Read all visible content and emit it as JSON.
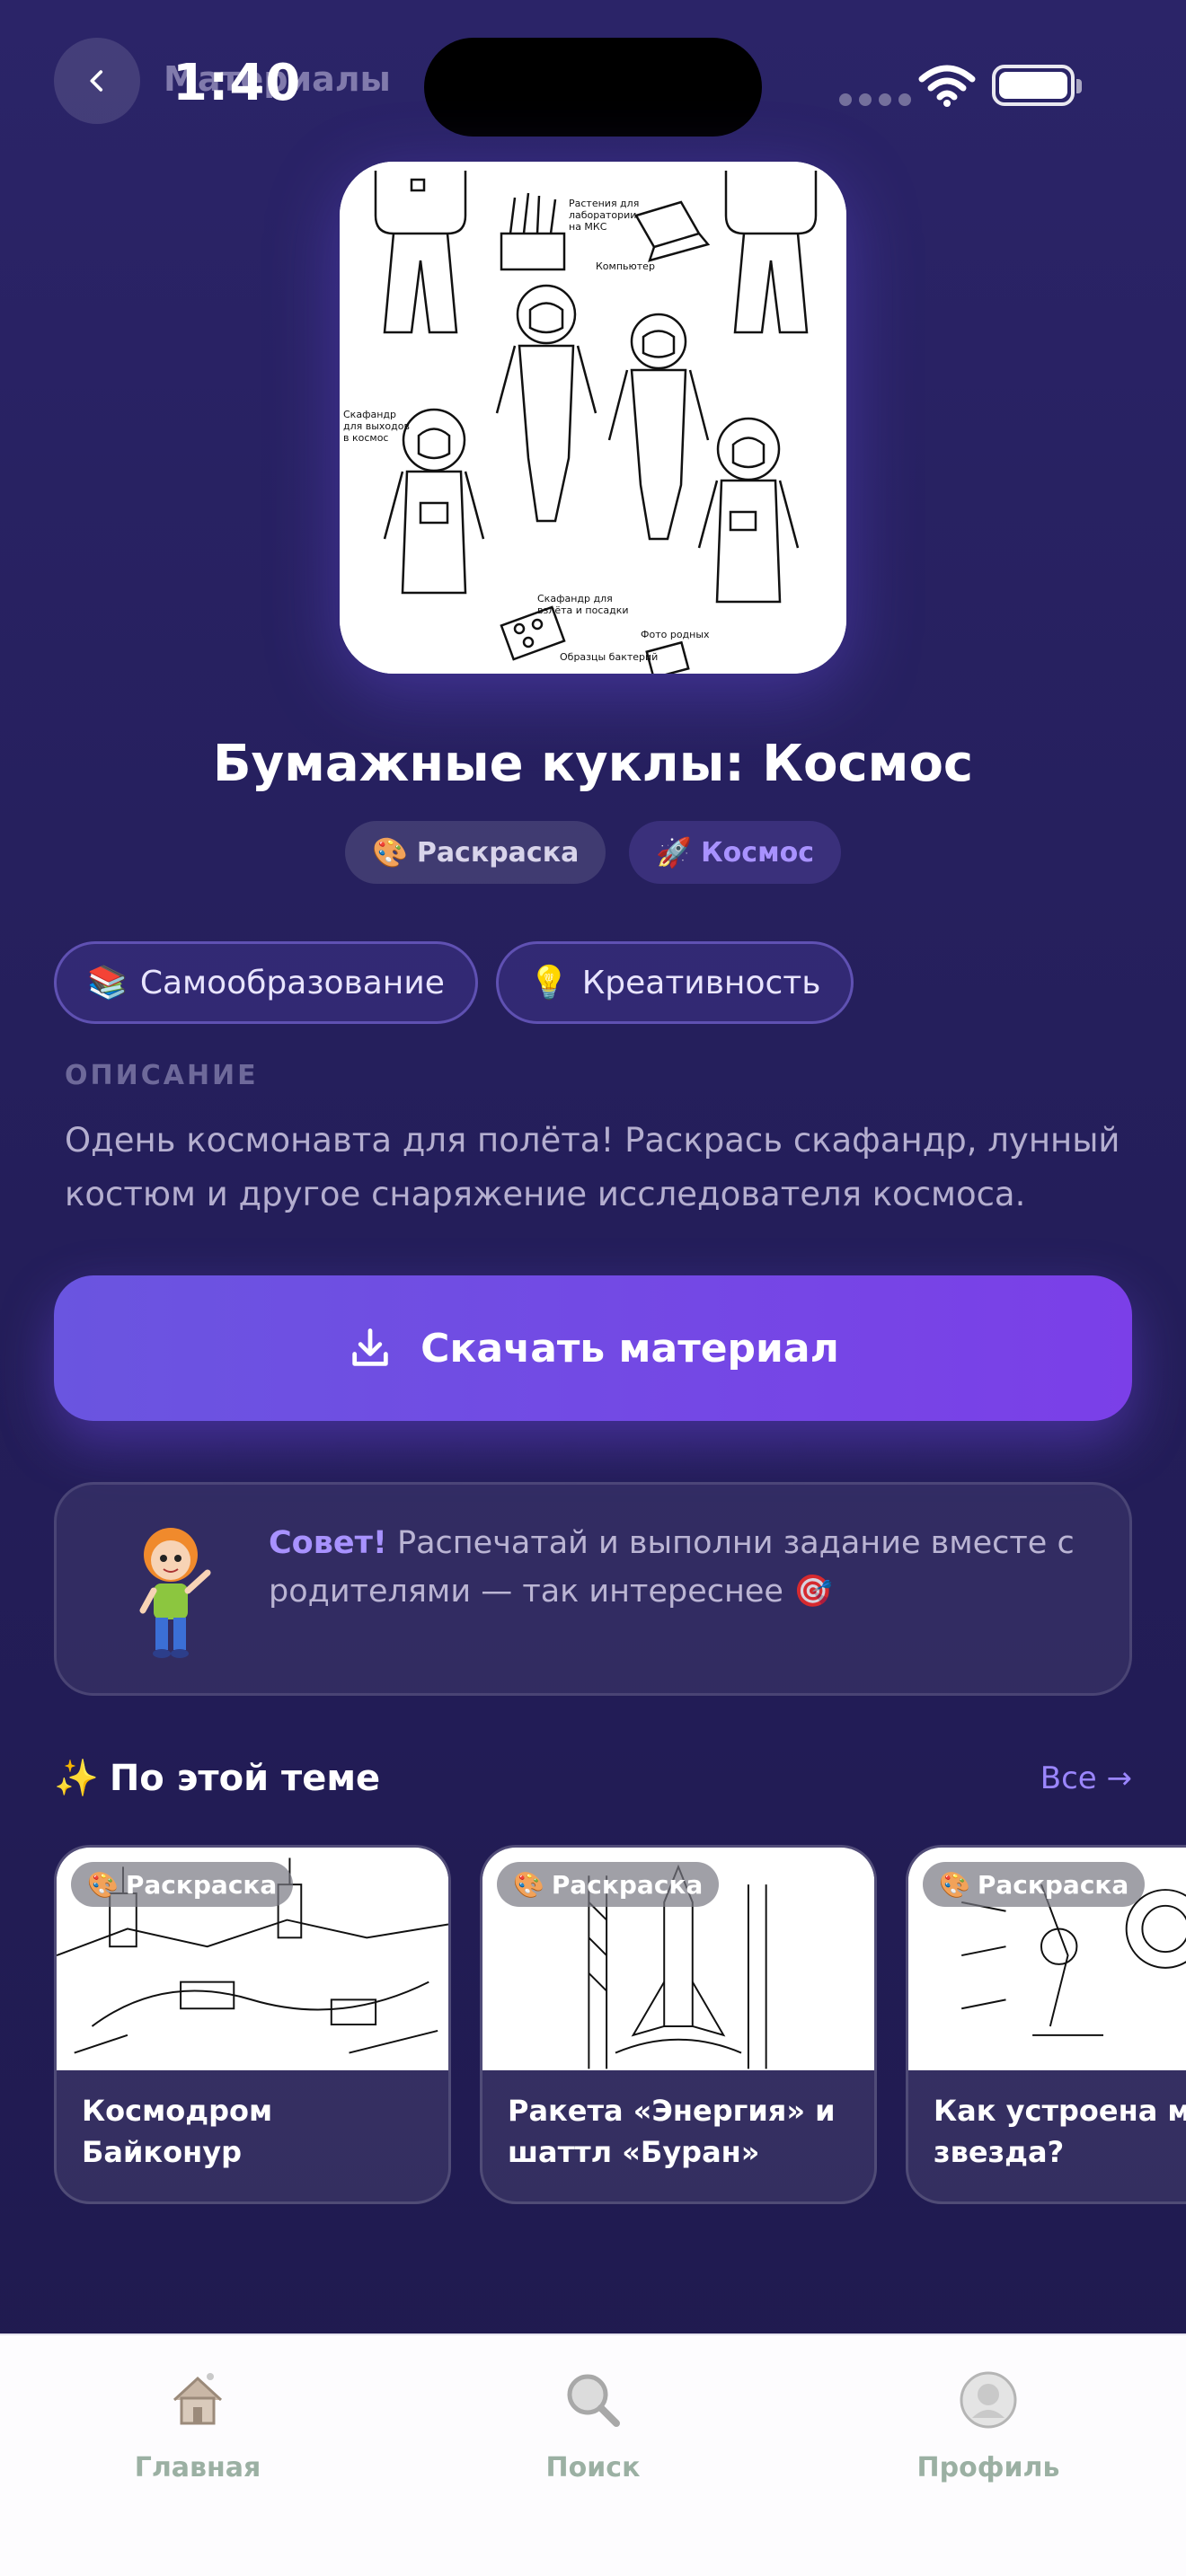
{
  "status_bar": {
    "time": "1:40"
  },
  "nav": {
    "title": "Материалы"
  },
  "material": {
    "title": "Бумажные куклы: Космос",
    "type_chip": {
      "emoji": "🎨",
      "label": "Раскраска"
    },
    "topic_chip": {
      "emoji": "🚀",
      "label": "Космос"
    },
    "tags": [
      {
        "emoji": "📚",
        "label": "Самообразование"
      },
      {
        "emoji": "💡",
        "label": "Креативность"
      }
    ],
    "description_label": "ОПИСАНИЕ",
    "description": "Одень космонавта для полёта! Раскрась скафандр, лунный костюм и другое снаряжение исследователя космоса.",
    "image_captions": [
      "Растения для лаборатории на МКС",
      "Компьютер",
      "Скафандр для выходов в космос",
      "Скафандр для взлёта и посадки",
      "Образцы бактерий",
      "Фото родных"
    ]
  },
  "download": {
    "label": "Скачать материал"
  },
  "tip": {
    "lead": "Совет!",
    "text": " Распечатай и выполни задание вместе с родителями — так интереснее 🎯"
  },
  "related": {
    "emoji": "✨",
    "title": "По этой теме",
    "all_label": "Все →",
    "items": [
      {
        "badge": "Раскраска",
        "badge_emoji": "🎨",
        "title": "Космодром Байконур"
      },
      {
        "badge": "Раскраска",
        "badge_emoji": "🎨",
        "title": "Ракета «Энергия» и\nшаттл «Буран»"
      },
      {
        "badge": "Раскраска",
        "badge_emoji": "🎨",
        "title": "Как устроена мор\nзвезда?"
      }
    ]
  },
  "tabbar": {
    "items": [
      {
        "label": "Главная",
        "icon": "home-icon"
      },
      {
        "label": "Поиск",
        "icon": "search-icon"
      },
      {
        "label": "Профиль",
        "icon": "profile-icon"
      }
    ]
  },
  "colors": {
    "accent": "#7b3fe8",
    "link": "#9b86ff",
    "background": "#251f5c"
  }
}
